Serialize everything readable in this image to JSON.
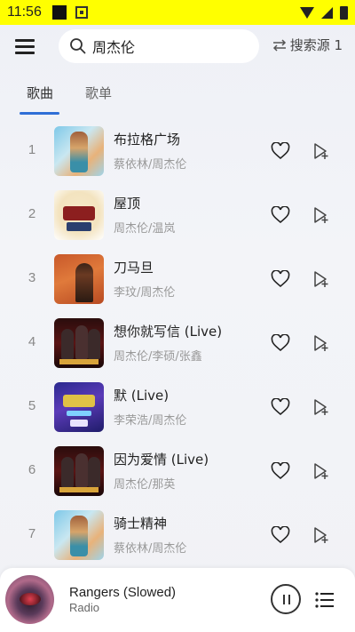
{
  "status": {
    "time": "11:56"
  },
  "search": {
    "query": "周杰伦",
    "source_label": "搜索源 1"
  },
  "tabs": [
    {
      "label": "歌曲"
    },
    {
      "label": "歌单"
    }
  ],
  "songs": [
    {
      "index": "1",
      "title": "布拉格广场",
      "artist": "蔡依林/周杰伦"
    },
    {
      "index": "2",
      "title": "屋顶",
      "artist": "周杰伦/温岚"
    },
    {
      "index": "3",
      "title": "刀马旦",
      "artist": "李玟/周杰伦"
    },
    {
      "index": "4",
      "title": "想你就写信 (Live)",
      "artist": "周杰伦/李硕/张鑫"
    },
    {
      "index": "5",
      "title": "默 (Live)",
      "artist": "李荣浩/周杰伦"
    },
    {
      "index": "6",
      "title": "因为爱情 (Live)",
      "artist": "周杰伦/那英"
    },
    {
      "index": "7",
      "title": "骑士精神",
      "artist": "蔡依林/周杰伦"
    }
  ],
  "player": {
    "title": "Rangers (Slowed)",
    "subtitle": "Radio"
  },
  "colors": {
    "status_bar": "#ffff00",
    "accent": "#2f6fd6"
  }
}
